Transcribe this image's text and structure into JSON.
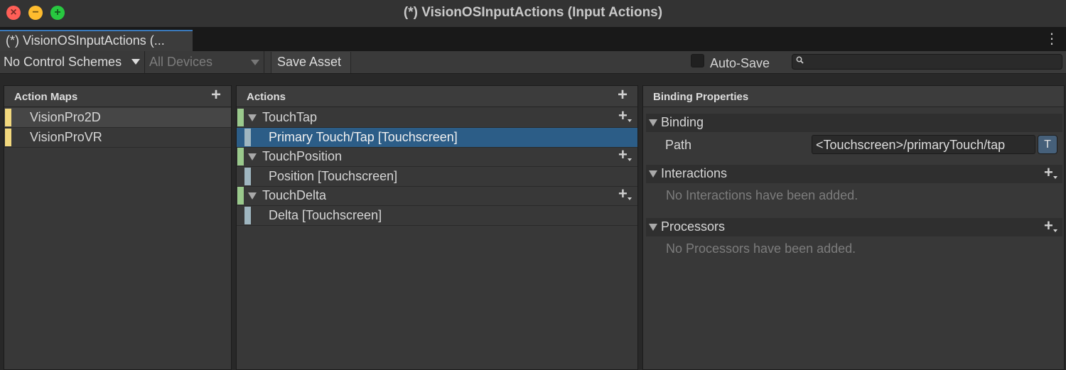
{
  "window": {
    "title": "(*) VisionOSInputActions (Input Actions)",
    "close_glyph": "×",
    "minimize_glyph": "−",
    "zoom_glyph": "+"
  },
  "tab": {
    "label": "(*) VisionOSInputActions (...",
    "more_glyph": "⋮"
  },
  "toolbar": {
    "control_schemes": "No Control Schemes",
    "devices": "All Devices",
    "save_asset": "Save Asset",
    "autosave_label": "Auto-Save",
    "autosave_checked": false,
    "search_value": ""
  },
  "action_maps": {
    "header": "Action Maps",
    "items": [
      {
        "label": "VisionPro2D",
        "selected": true,
        "color": "#f2d87e"
      },
      {
        "label": "VisionProVR",
        "selected": false,
        "color": "#f2d87e"
      }
    ]
  },
  "actions": {
    "header": "Actions",
    "items": [
      {
        "label": "TouchTap",
        "binding": "Primary Touch/Tap [Touchscreen]",
        "binding_selected": true
      },
      {
        "label": "TouchPosition",
        "binding": "Position [Touchscreen]",
        "binding_selected": false
      },
      {
        "label": "TouchDelta",
        "binding": "Delta [Touchscreen]",
        "binding_selected": false
      }
    ],
    "action_color": "#9ac98c",
    "binding_color": "#9fb6c0"
  },
  "binding_properties": {
    "header": "Binding Properties",
    "binding_section": "Binding",
    "path_label": "Path",
    "path_value": "<Touchscreen>/primaryTouch/tap",
    "t_button": "T",
    "interactions_section": "Interactions",
    "interactions_empty": "No Interactions have been added.",
    "processors_section": "Processors",
    "processors_empty": "No Processors have been added."
  },
  "colors": {
    "selection": "#2c5d87",
    "tab_accent": "#3a79bb"
  }
}
